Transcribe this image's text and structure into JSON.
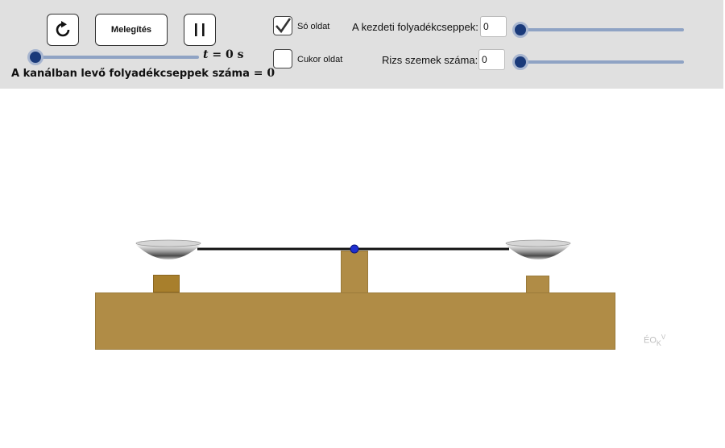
{
  "toolbar": {
    "reset_icon": "rotate-reset-icon",
    "heat_button_label": "Melegítés",
    "pause_icon": "pause-icon"
  },
  "time": {
    "variable": "t",
    "equals": "=",
    "value": "0",
    "unit": "s",
    "slider_value": 0
  },
  "drops_in_spoon": {
    "label": "A kanálban levő folyadékcseppek száma",
    "equals": "=",
    "value": "0"
  },
  "options": {
    "salt_solution": {
      "label": "Só oldat",
      "checked": true
    },
    "sugar_solution": {
      "label": "Cukor oldat",
      "checked": false
    }
  },
  "initial_drops": {
    "label": "A kezdeti folyadékcseppek:",
    "value": "0",
    "slider_value": 0
  },
  "rice_grains": {
    "label": "Rizs szemek száma:",
    "value": "0",
    "slider_value": 0
  },
  "watermark": {
    "main": "ÉO",
    "sub": "K",
    "sup": "V"
  },
  "colors": {
    "toolbar_bg": "#e0e0e0",
    "wood": "#b08c46",
    "slider_track": "#8fa3c4",
    "slider_knob": "#1a3a7a",
    "pivot": "#1f2fd0"
  }
}
